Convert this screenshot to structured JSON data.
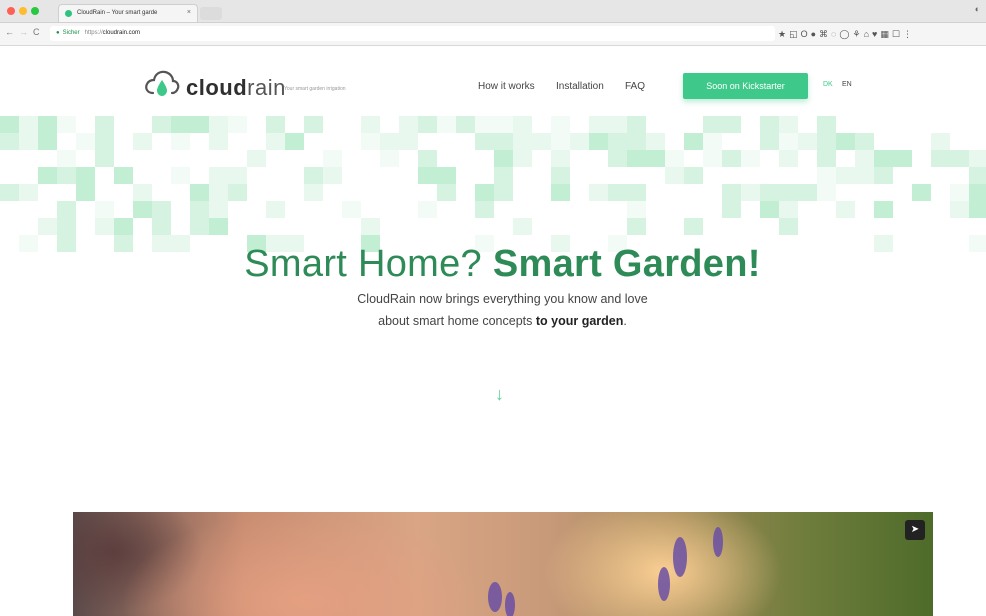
{
  "browser": {
    "tab_title": "CloudRain – Your smart garde",
    "tab_close": "×",
    "secure_label": "Sicher",
    "url_scheme": "https://",
    "url_host": "cloudrain.com",
    "back": "←",
    "forward": "→",
    "reload": "C",
    "menu_dots": "⋮",
    "extension_icons": [
      "★",
      "◱",
      "O",
      "●",
      "⌘",
      "◌",
      "◯",
      "⚘",
      "⌂",
      "♥",
      "▦",
      "☐",
      "⋮"
    ]
  },
  "header": {
    "logo_bold": "cloud",
    "logo_light": "rain",
    "tagline": "Your smart garden irrigation",
    "nav": [
      "How it works",
      "Installation",
      "FAQ"
    ],
    "cta": "Soon on Kickstarter",
    "lang_dk": "DK",
    "lang_en": "EN"
  },
  "hero": {
    "title_light": "Smart Home?",
    "title_bold": "Smart Garden!",
    "subtitle_line1": "CloudRain now brings everything you know and love",
    "subtitle_line2_plain": "about smart home concepts",
    "subtitle_line2_bold": "to your garden",
    "subtitle_end": ".",
    "scroll_arrow": "↓"
  },
  "photo": {
    "share_icon": "➤"
  },
  "colors": {
    "accent": "#3ec98a",
    "heading": "#2e8b57",
    "pixel_band_palette": [
      "#e9f8ef",
      "#d6f3e2",
      "#c2eed4",
      "#f3fbf6"
    ]
  }
}
